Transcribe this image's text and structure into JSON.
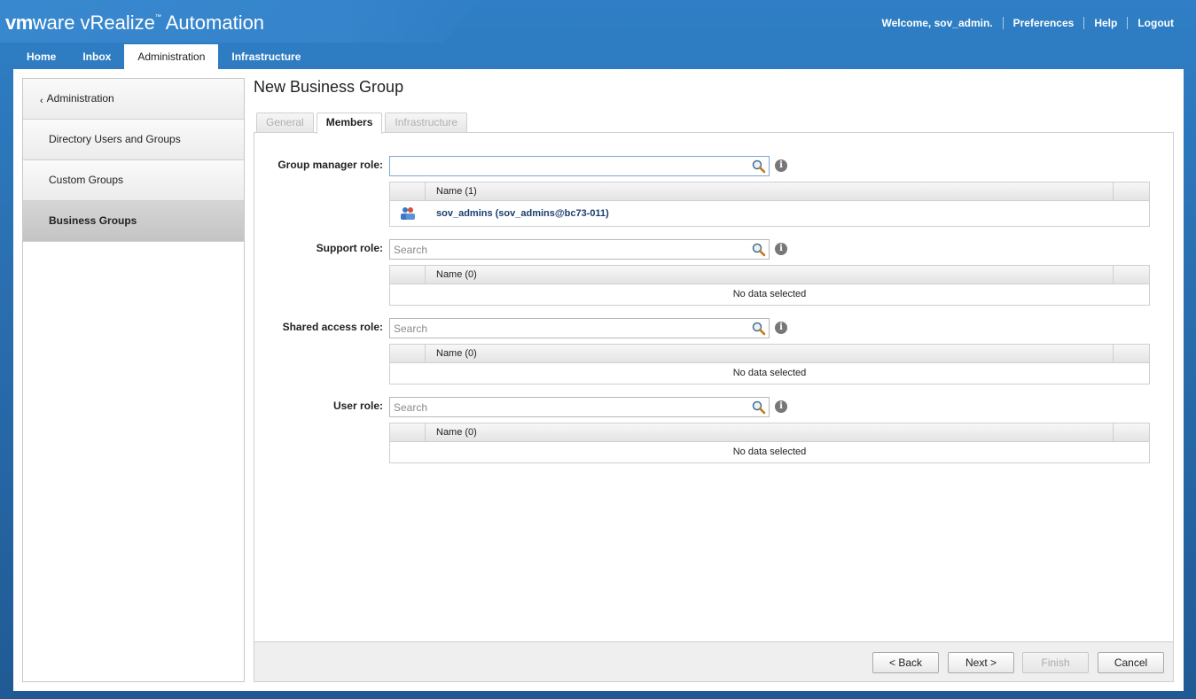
{
  "header": {
    "logo_vm": "vm",
    "logo_ware": "ware",
    "product": "vRealize",
    "product_tm": "™",
    "product_suffix": " Automation",
    "welcome": "Welcome, sov_admin.",
    "preferences": "Preferences",
    "help": "Help",
    "logout": "Logout"
  },
  "nav": {
    "tabs": [
      {
        "label": "Home"
      },
      {
        "label": "Inbox"
      },
      {
        "label": "Administration",
        "active": true
      },
      {
        "label": "Infrastructure"
      }
    ]
  },
  "sidebar": {
    "items": [
      {
        "label": "Administration",
        "type": "back"
      },
      {
        "label": "Directory Users and Groups"
      },
      {
        "label": "Custom Groups"
      },
      {
        "label": "Business Groups",
        "active": true
      }
    ]
  },
  "page": {
    "title": "New Business Group",
    "tabs": [
      {
        "label": "General",
        "state": "disabled"
      },
      {
        "label": "Members",
        "state": "active"
      },
      {
        "label": "Infrastructure",
        "state": "disabled"
      }
    ]
  },
  "roles": [
    {
      "label": "Group manager role:",
      "value": "",
      "placeholder": "",
      "column": "Name (1)",
      "rows": [
        {
          "icon": "user-group-icon",
          "name": "sov_admins (sov_admins@bc73-011)"
        }
      ]
    },
    {
      "label": "Support role:",
      "value": "",
      "placeholder": "Search",
      "column": "Name (0)",
      "empty": "No data selected"
    },
    {
      "label": "Shared access role:",
      "value": "",
      "placeholder": "Search",
      "column": "Name (0)",
      "empty": "No data selected"
    },
    {
      "label": "User role:",
      "value": "",
      "placeholder": "Search",
      "column": "Name (0)",
      "empty": "No data selected"
    }
  ],
  "footer": {
    "back": "< Back",
    "next": "Next >",
    "finish": "Finish",
    "cancel": "Cancel"
  },
  "info_icon_glyph": "i",
  "colors": {
    "header_blue": "#2f7fc6",
    "selected_name": "#1c3d6e"
  }
}
